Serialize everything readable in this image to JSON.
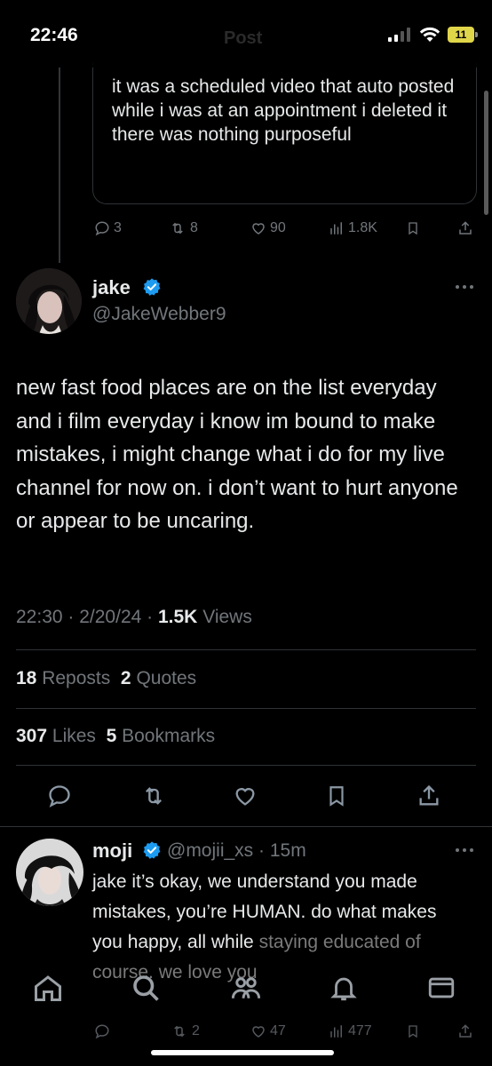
{
  "status_bar": {
    "time": "22:46",
    "header_title_ghost": "Post",
    "battery": "11",
    "battery_color": "#e0d64a"
  },
  "quoted_tweet": {
    "text": "it was a scheduled video that auto posted while i was at an appointment i deleted it there was nothing purposeful",
    "actions": {
      "replies": "3",
      "reposts": "8",
      "likes": "90",
      "views": "1.8K"
    }
  },
  "main_tweet": {
    "name": "jake",
    "handle": "@JakeWebber9",
    "text": "new fast food places are on the list everyday and i film everyday i know im bound to make mistakes, i might change what i do for my live channel for now on. i don’t want to hurt anyone or appear to be uncaring.",
    "time": "22:30",
    "date": "2/20/24",
    "views_count": "1.5K",
    "views_label": "Views",
    "reposts_count": "18",
    "reposts_label": "Reposts",
    "quotes_count": "2",
    "quotes_label": "Quotes",
    "likes_count": "307",
    "likes_label": "Likes",
    "bookmarks_count": "5",
    "bookmarks_label": "Bookmarks"
  },
  "reply": {
    "name": "moji",
    "handle": "@mojii_xs",
    "time": "15m",
    "text_main": "jake it’s okay, we understand you made mistakes, you’re HUMAN. do what makes you happy, all while ",
    "text_faded": "staying educated of course. we love you",
    "actions": {
      "reposts": "2",
      "likes": "47",
      "views": "477"
    }
  },
  "colors": {
    "background": "#000000",
    "text": "#e7e9ea",
    "secondary": "#71767b",
    "verified": "#1d9bf0",
    "divider": "#2f3336"
  },
  "icons": [
    "reply-icon",
    "repost-icon",
    "like-icon",
    "views-icon",
    "bookmark-icon",
    "share-icon",
    "verified-badge-icon",
    "more-icon",
    "home-icon",
    "search-icon",
    "communities-icon",
    "notifications-icon",
    "messages-icon"
  ]
}
